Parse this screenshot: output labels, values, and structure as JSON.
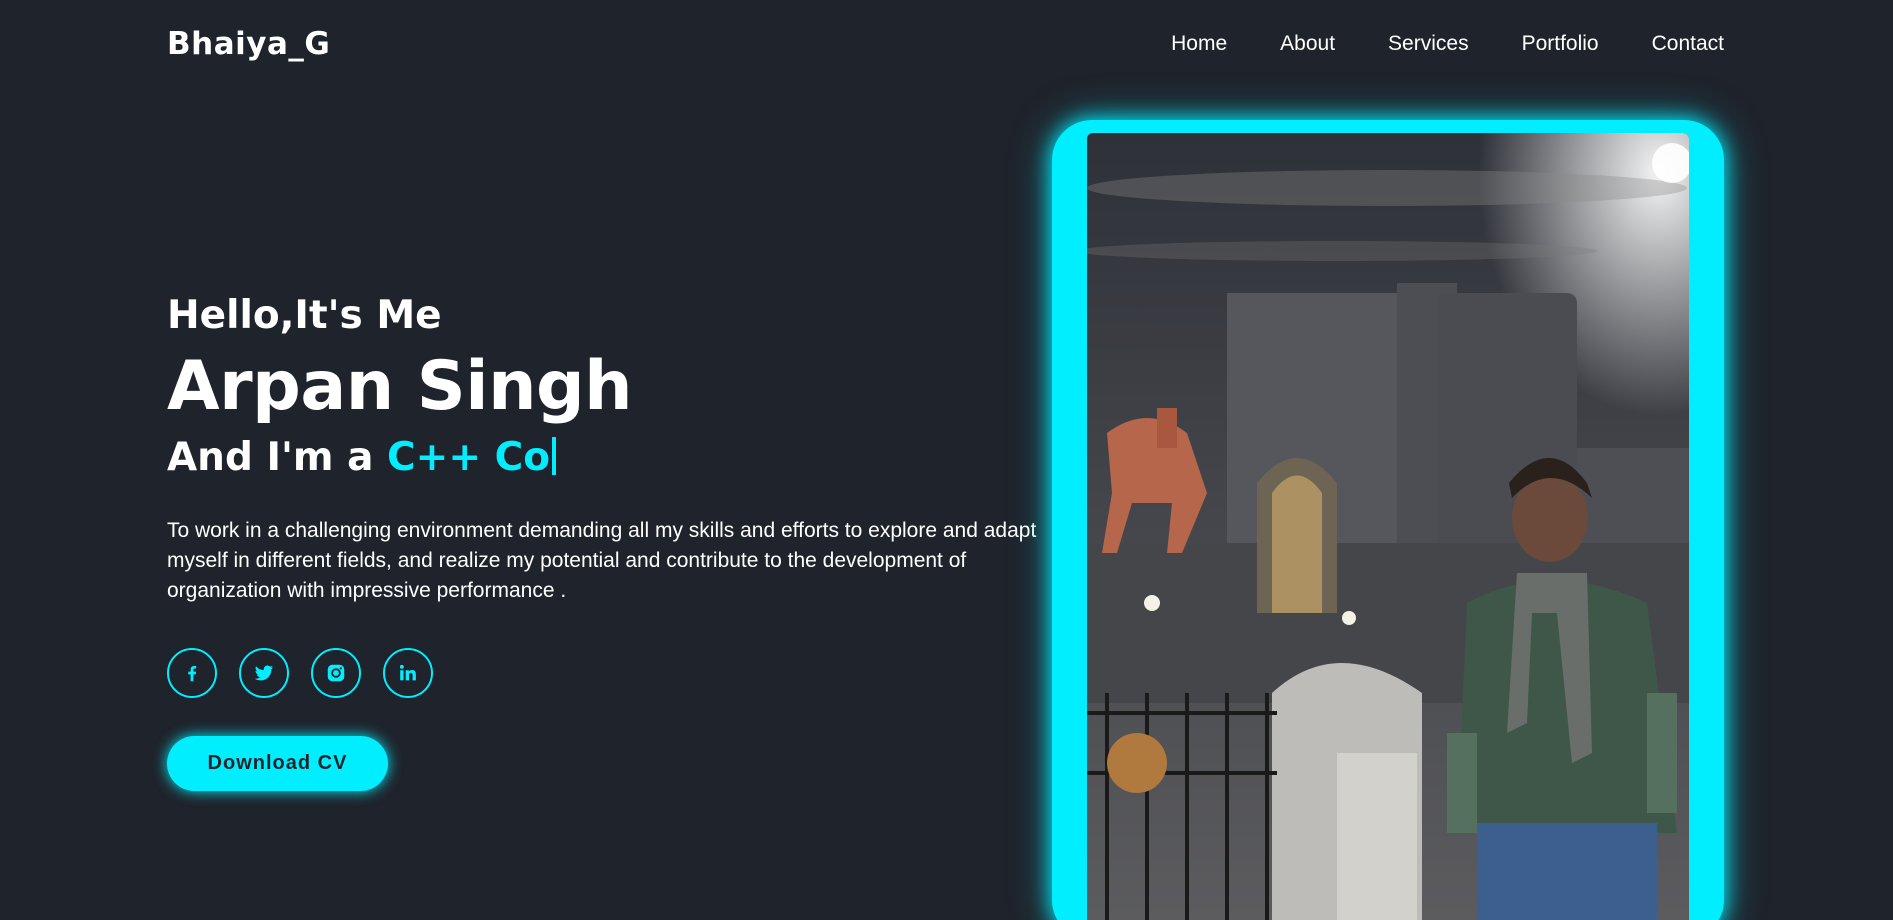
{
  "header": {
    "logo": "Bhaiya_G",
    "nav": [
      "Home",
      "About",
      "Services",
      "Portfolio",
      "Contact"
    ]
  },
  "home": {
    "greeting": "Hello,It's Me",
    "name": "Arpan Singh",
    "role_prefix": "And I'm a ",
    "role_typed": "C++ Co",
    "description": "To work in a challenging environment demanding all my skills and efforts to explore and adapt myself in different fields, and realize my potential and contribute to the development of organization with impressive performance .",
    "socials": [
      "facebook-icon",
      "twitter-icon",
      "instagram-icon",
      "linkedin-icon"
    ],
    "button": "Download CV"
  },
  "colors": {
    "background": "#1f232b",
    "accent": "#00eeff",
    "text": "#ffffff"
  }
}
